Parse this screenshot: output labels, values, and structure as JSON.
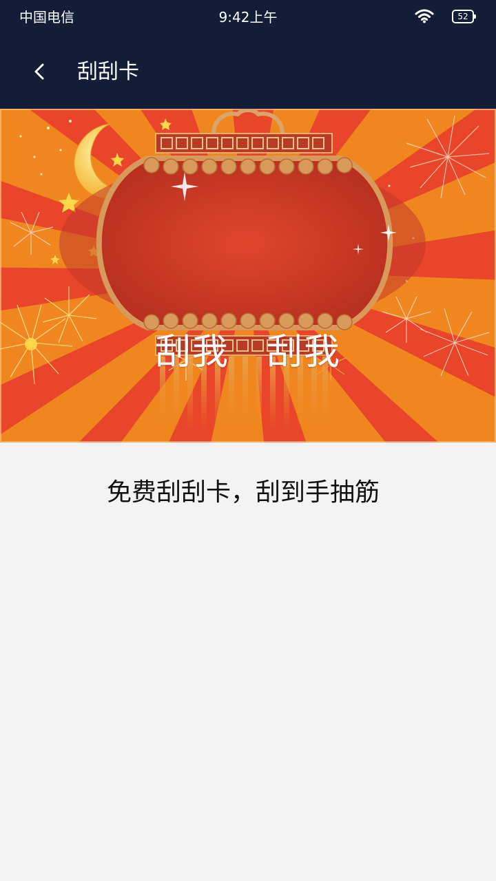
{
  "status_bar": {
    "carrier": "中国电信",
    "time": "9:42上午",
    "battery_level": "52"
  },
  "nav": {
    "back_icon": "chevron-left-icon",
    "title": "刮刮卡"
  },
  "scratch_card": {
    "label": "刮我　刮我",
    "colors": {
      "ray_dark": "#e8452a",
      "ray_light": "#f0871e",
      "lantern": "#cc3a26",
      "lantern_rim": "#d89a5a",
      "gold": "#f4c33a"
    }
  },
  "tagline": "免费刮刮卡，刮到手抽筋",
  "colors": {
    "header": "#131d38",
    "background": "#f2f3f2"
  }
}
